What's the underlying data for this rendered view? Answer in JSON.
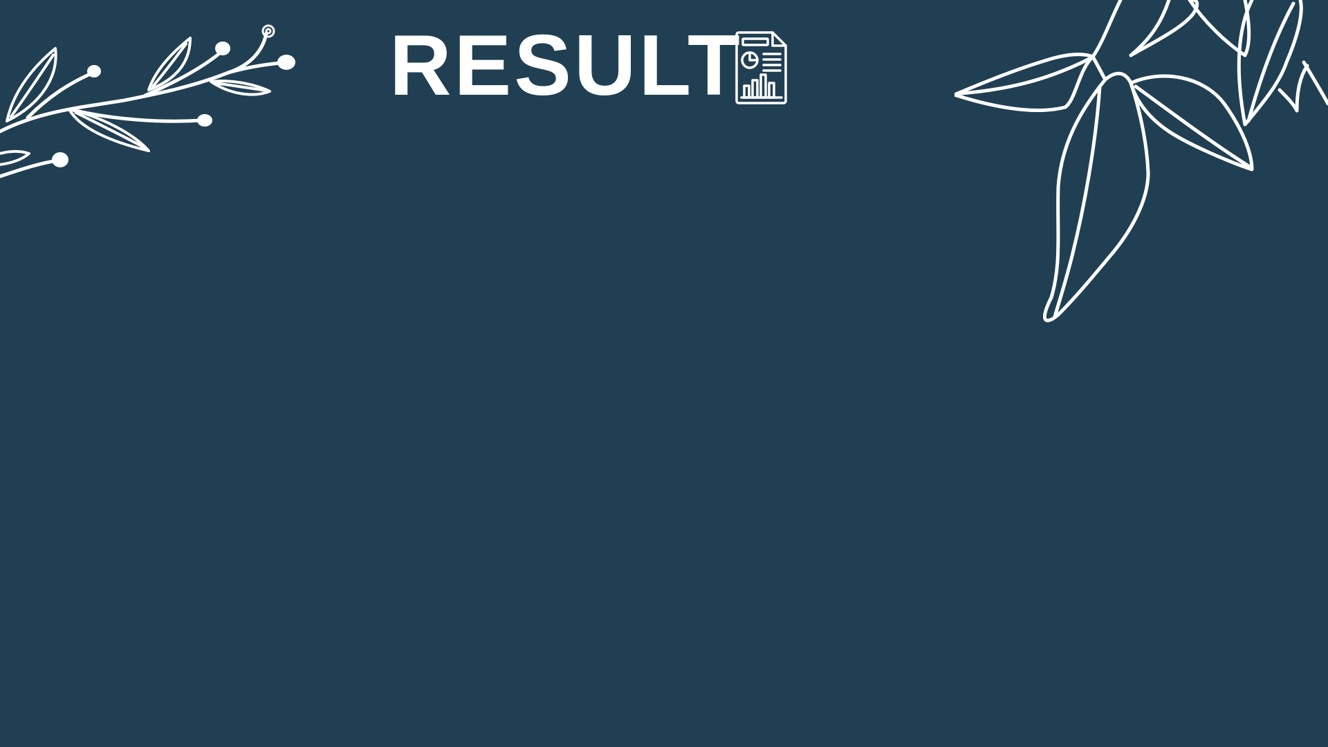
{
  "slide": {
    "title": "RESULT",
    "background_color": "#213f52",
    "foreground_color": "#ffffff"
  },
  "icons": {
    "title_icon": "report-document-icon",
    "left_decoration": "olive-branch-icon",
    "right_decoration": "leaves-icon"
  }
}
